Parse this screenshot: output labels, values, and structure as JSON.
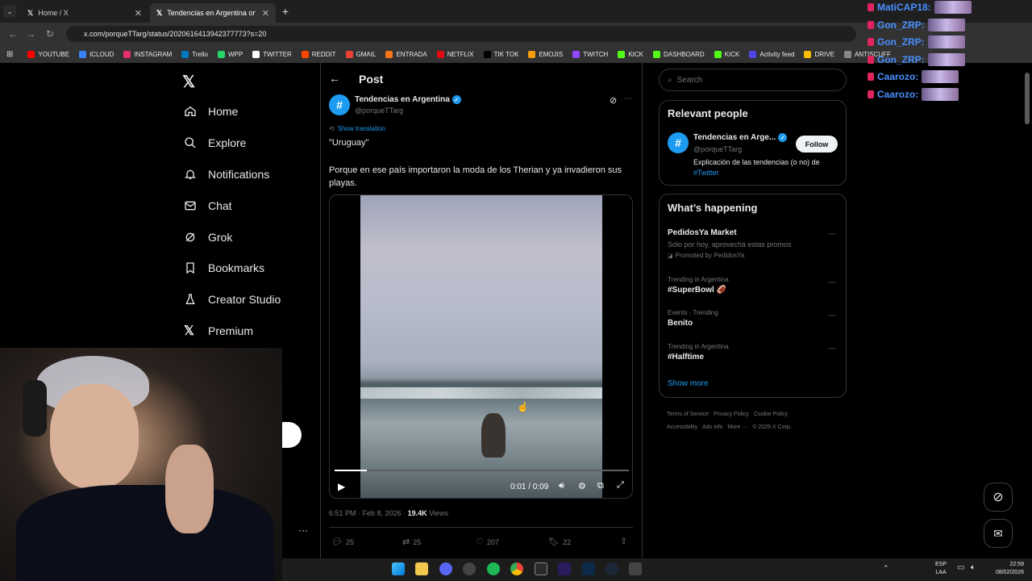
{
  "browser": {
    "tabs": [
      {
        "label": "Home / X"
      },
      {
        "label": "Tendencias en Argentina on X"
      }
    ],
    "url": "x.com/porqueTTarg/status/2020616413942377773?s=20",
    "bookmarks": [
      "YOUTUBE",
      "ICLOUD",
      "INSTAGRAM",
      "Trello",
      "WPP",
      "TWITTER",
      "REDDIT",
      "GMAIL",
      "ENTRADA",
      "NETFLIX",
      "TIK TOK",
      "EMOJIS",
      "TWITCH",
      "KICK",
      "DASHBOARD",
      "KICK",
      "Activity feed",
      "DRIVE",
      "ANTISCUFF"
    ]
  },
  "sidebar": {
    "items": [
      {
        "label": "Home"
      },
      {
        "label": "Explore"
      },
      {
        "label": "Notifications"
      },
      {
        "label": "Chat"
      },
      {
        "label": "Grok"
      },
      {
        "label": "Bookmarks"
      },
      {
        "label": "Creator Studio"
      },
      {
        "label": "Premium"
      }
    ]
  },
  "post": {
    "header_title": "Post",
    "author_name": "Tendencias en Argentina",
    "author_handle": "@porqueTTarg",
    "show_translation": "Show translation",
    "quote": "\"Uruguay\"",
    "body": "Porque en ese país importaron la moda de los Therian y ya invadieron sus playas.",
    "video_time": "0:01 / 0:09",
    "video_progress": 0.11,
    "timestamp": "6:51 PM · Feb 8, 2026 · ",
    "views_count": "19.4K",
    "views_label": " Views",
    "replies": "25",
    "reposts": "25",
    "likes": "207",
    "bookmarks": "22"
  },
  "right": {
    "search_placeholder": "Search",
    "relevant_title": "Relevant people",
    "person_name": "Tendencias en Arge...",
    "person_handle": "@porqueTTarg",
    "follow_label": "Follow",
    "person_bio": "Explicación de las tendencias (o no) de",
    "person_bio_tag": "#Twitter",
    "happening_title": "What’s happening",
    "trends": [
      {
        "meta": "",
        "title": "PedidosYa Market",
        "sub": "Sólo por hoy, aprovechá estas promos",
        "promoted": "Promoted by PedidosYa"
      },
      {
        "meta": "Trending in Argentina",
        "title": "#SuperBowl 🏈"
      },
      {
        "meta": "Events · Trending",
        "title": "Benito"
      },
      {
        "meta": "Trending in Argentina",
        "title": "#Halftime"
      }
    ],
    "show_more": "Show more",
    "footer": [
      "Terms of Service",
      "Privacy Policy",
      "Cookie Policy",
      "Accessibility",
      "Ads info",
      "More ···",
      "© 2026 X Corp."
    ]
  },
  "chat": {
    "lines": [
      {
        "user": "MatiCAP18:",
        "color": "#4a90ff"
      },
      {
        "user": "Gon_ZRP:",
        "color": "#4a90ff"
      },
      {
        "user": "Gon_ZRP:",
        "color": "#4a90ff"
      },
      {
        "user": "Gon_ZRP:",
        "color": "#4a90ff"
      },
      {
        "user": "Caarozo:",
        "color": "#4a90ff"
      },
      {
        "user": "Caarozo:",
        "color": "#4a90ff"
      }
    ]
  },
  "tray": {
    "lang": "ESP",
    "region": "LAA",
    "time": "22:59",
    "date": "08/02/2026"
  },
  "colors": {
    "accent": "#1d9bf0",
    "verified": "#1d9bf0",
    "background": "#000000"
  }
}
